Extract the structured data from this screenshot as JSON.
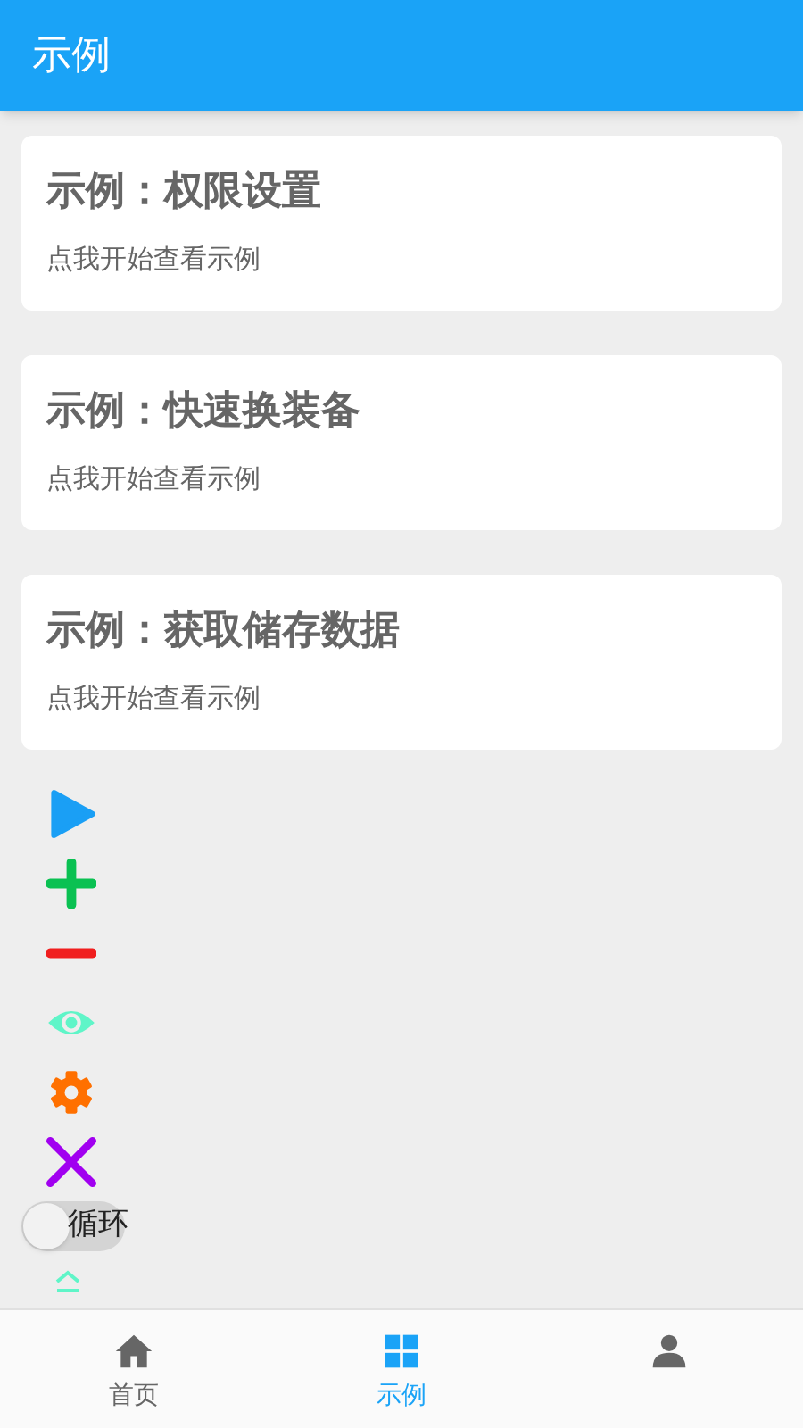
{
  "app_bar": {
    "title": "示例"
  },
  "cards": [
    {
      "title": "示例：权限设置",
      "subtitle": "点我开始查看示例"
    },
    {
      "title": "示例：快速换装备",
      "subtitle": "点我开始查看示例"
    },
    {
      "title": "示例：获取储存数据",
      "subtitle": "点我开始查看示例"
    }
  ],
  "tool_buttons": [
    {
      "kind": "play"
    },
    {
      "kind": "plus"
    },
    {
      "kind": "minus"
    },
    {
      "kind": "eye"
    },
    {
      "kind": "gear"
    },
    {
      "kind": "close"
    }
  ],
  "loop_toggle": {
    "label": "循环",
    "on": false
  },
  "collapse_button": {
    "kind": "chevron"
  },
  "bottom_nav": [
    {
      "kind": "home",
      "label": "首页",
      "selected": false
    },
    {
      "kind": "grid",
      "label": "示例",
      "selected": true
    },
    {
      "kind": "person",
      "selected": false
    }
  ]
}
